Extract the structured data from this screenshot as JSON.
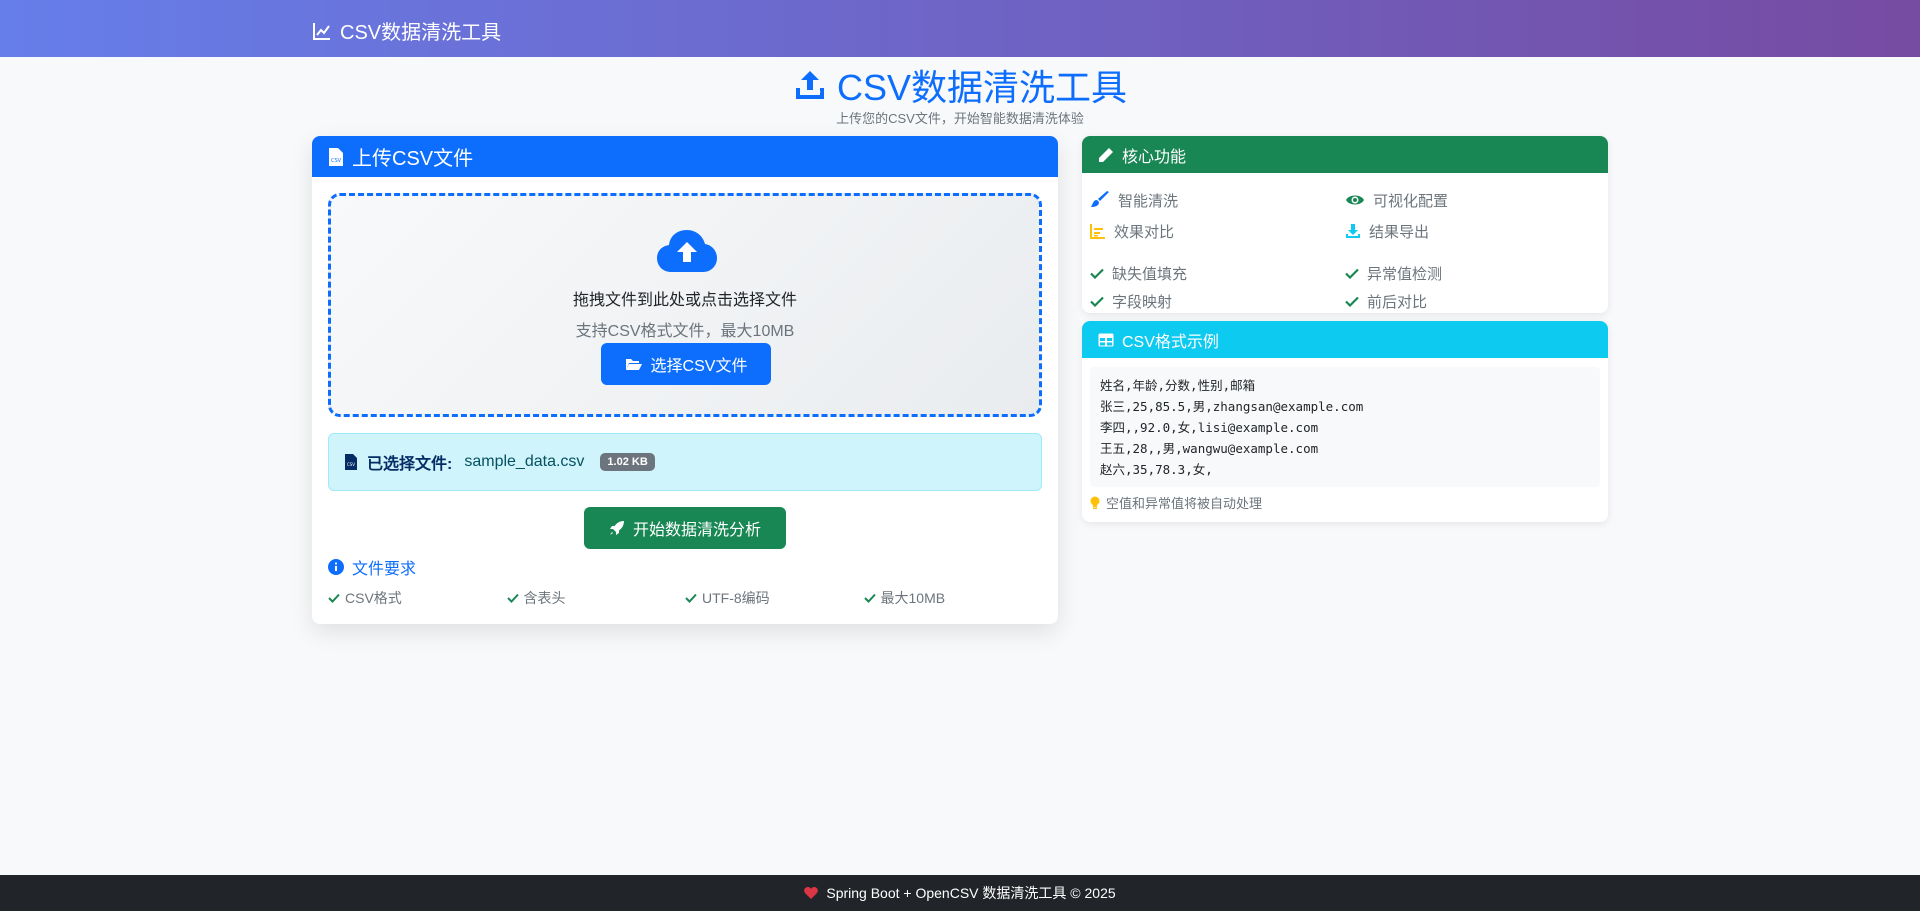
{
  "navbar": {
    "brand": "CSV数据清洗工具"
  },
  "hero": {
    "title": "CSV数据清洗工具",
    "subtitle": "上传您的CSV文件，开始智能数据清洗体验"
  },
  "upload_card": {
    "header": "上传CSV文件",
    "dropzone": {
      "main_text": "拖拽文件到此处或点击选择文件",
      "sub_text": "支持CSV格式文件，最大10MB",
      "choose_button": "选择CSV文件"
    },
    "selected_file": {
      "label": "已选择文件:",
      "name": "sample_data.csv",
      "size": "1.02 KB"
    },
    "start_button": "开始数据清洗分析",
    "requirements": {
      "title": "文件要求",
      "items": [
        "CSV格式",
        "含表头",
        "UTF-8编码",
        "最大10MB"
      ]
    }
  },
  "features_card": {
    "header": "核心功能",
    "features": [
      {
        "label": "智能清洗",
        "icon": "brush-icon",
        "color": "#0d6efd"
      },
      {
        "label": "可视化配置",
        "icon": "eye-icon",
        "color": "#198754"
      },
      {
        "label": "效果对比",
        "icon": "bar-chart-icon",
        "color": "#ffc107"
      },
      {
        "label": "结果导出",
        "icon": "download-icon",
        "color": "#0dcaf0"
      }
    ],
    "checks": [
      "缺失值填充",
      "异常值检测",
      "字段映射",
      "前后对比"
    ]
  },
  "sample_card": {
    "header": "CSV格式示例",
    "lines": [
      "姓名,年龄,分数,性别,邮箱",
      "张三,25,85.5,男,zhangsan@example.com",
      "李四,,92.0,女,lisi@example.com",
      "王五,28,,男,wangwu@example.com",
      "赵六,35,78.3,女,"
    ],
    "tip": "空值和异常值将被自动处理"
  },
  "footer": {
    "text": "Spring Boot + OpenCSV 数据清洗工具 © 2025"
  },
  "colors": {
    "primary": "#0d6efd",
    "success": "#198754",
    "info": "#0dcaf0",
    "warning": "#ffc107",
    "danger": "#dc3545",
    "navbar_gradient_start": "#667eea",
    "navbar_gradient_end": "#764ba2"
  }
}
